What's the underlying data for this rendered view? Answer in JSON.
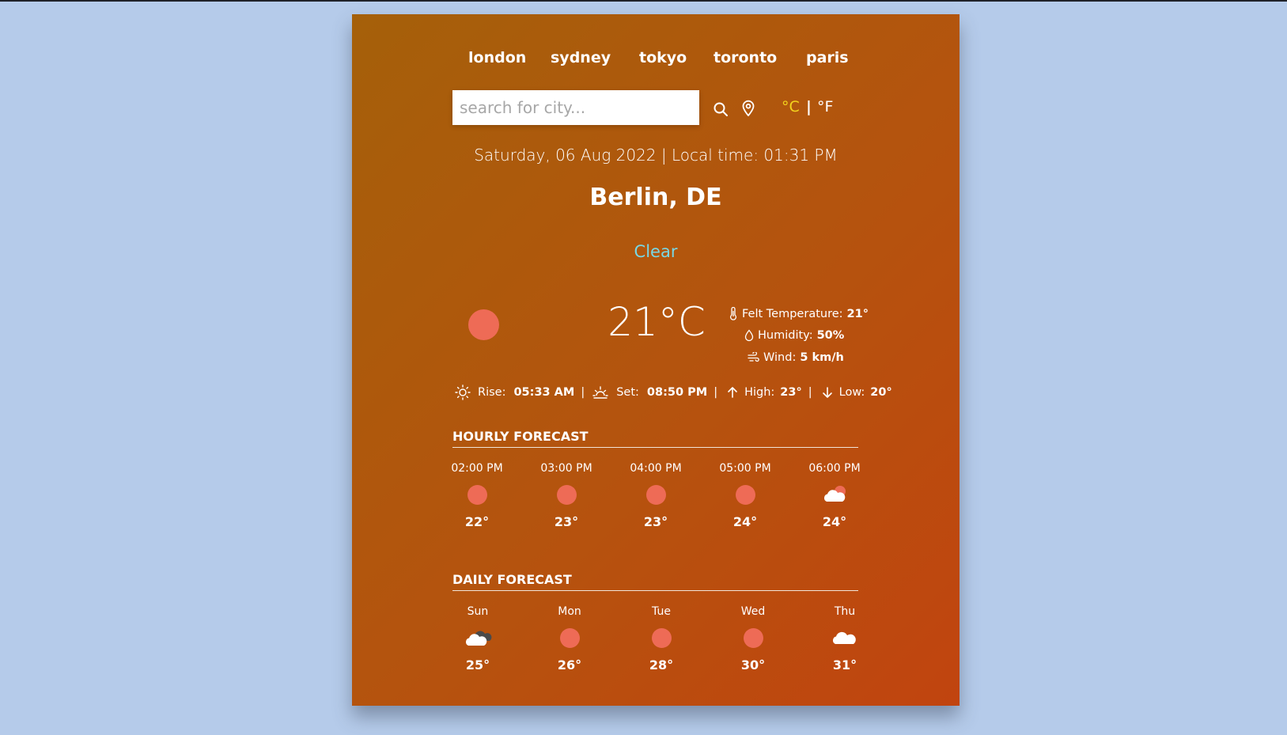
{
  "cities": [
    {
      "label": "london"
    },
    {
      "label": "sydney"
    },
    {
      "label": "tokyo"
    },
    {
      "label": "toronto"
    },
    {
      "label": "paris"
    }
  ],
  "search": {
    "placeholder": "search for city..."
  },
  "units": {
    "celsius": "°C",
    "separator": "|",
    "fahrenheit": "°F",
    "active_color": "#f3d31e"
  },
  "datetime": "Saturday, 06 Aug 2022 | Local time: 01:31 PM",
  "location": "Berlin, DE",
  "condition": "Clear",
  "condition_color": "#79d7e4",
  "current": {
    "temperature": "21°C",
    "felt_label": "Felt Temperature:",
    "felt_value": "21°",
    "humidity_label": "Humidity:",
    "humidity_value": "50%",
    "wind_label": "Wind:",
    "wind_value": "5 km/h"
  },
  "sun": {
    "rise_label": "Rise:",
    "rise_value": "05:33 AM",
    "set_label": "Set:",
    "set_value": "08:50 PM",
    "high_label": "High:",
    "high_value": "23°",
    "low_label": "Low:",
    "low_value": "20°",
    "separator": "|"
  },
  "hourly": {
    "title": "HOURLY FORECAST",
    "items": [
      {
        "time": "02:00 PM",
        "icon": "sun-icon",
        "temp": "22°"
      },
      {
        "time": "03:00 PM",
        "icon": "sun-icon",
        "temp": "23°"
      },
      {
        "time": "04:00 PM",
        "icon": "sun-icon",
        "temp": "23°"
      },
      {
        "time": "05:00 PM",
        "icon": "sun-icon",
        "temp": "24°"
      },
      {
        "time": "06:00 PM",
        "icon": "cloud-sun-icon",
        "temp": "24°"
      }
    ]
  },
  "daily": {
    "title": "DAILY FORECAST",
    "items": [
      {
        "day": "Sun",
        "icon": "cloud-dark-icon",
        "temp": "25°"
      },
      {
        "day": "Mon",
        "icon": "sun-icon",
        "temp": "26°"
      },
      {
        "day": "Tue",
        "icon": "sun-icon",
        "temp": "28°"
      },
      {
        "day": "Wed",
        "icon": "sun-icon",
        "temp": "30°"
      },
      {
        "day": "Thu",
        "icon": "cloud-icon",
        "temp": "31°"
      }
    ]
  },
  "colors": {
    "page_bg": "#b5cbea",
    "sun": "#ee6b56",
    "card_gradient_start": "#a5600a",
    "card_gradient_end": "#c1440f"
  }
}
